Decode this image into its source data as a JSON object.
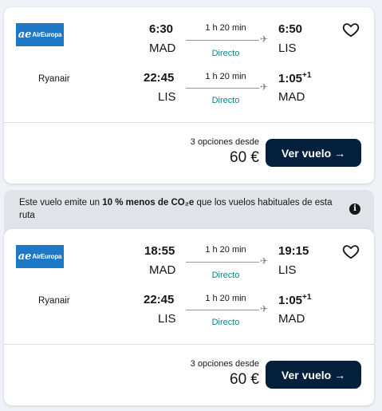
{
  "results": [
    {
      "airline_logo_text": "AirEuropa",
      "airline_logo_mark": "ae",
      "legs": [
        {
          "dep_time": "6:30",
          "dep_code": "MAD",
          "duration": "1 h 20 min",
          "stops": "Directo",
          "arr_time": "6:50",
          "arr_offset": "",
          "arr_code": "LIS"
        },
        {
          "airline": "Ryanair",
          "dep_time": "22:45",
          "dep_code": "LIS",
          "duration": "1 h 20 min",
          "stops": "Directo",
          "arr_time": "1:05",
          "arr_offset": "+1",
          "arr_code": "MAD"
        }
      ],
      "options_text": "3 opciones desde",
      "price": "60 €",
      "button_label": "Ver vuelo →"
    },
    {
      "airline_logo_text": "AirEuropa",
      "airline_logo_mark": "ae",
      "legs": [
        {
          "dep_time": "18:55",
          "dep_code": "MAD",
          "duration": "1 h 20 min",
          "stops": "Directo",
          "arr_time": "19:15",
          "arr_offset": "",
          "arr_code": "LIS"
        },
        {
          "airline": "Ryanair",
          "dep_time": "22:45",
          "dep_code": "LIS",
          "duration": "1 h 20 min",
          "stops": "Directo",
          "arr_time": "1:05",
          "arr_offset": "+1",
          "arr_code": "MAD"
        }
      ],
      "options_text": "3 opciones desde",
      "price": "60 €",
      "button_label": "Ver vuelo →"
    }
  ],
  "eco_banner": {
    "prefix": "Este vuelo emite un ",
    "highlight": "10 % menos de CO₂e",
    "suffix": " que los vuelos habituales de esta ruta"
  },
  "icons": {
    "plane": "plane-icon",
    "heart": "heart-icon",
    "info": "info-icon"
  },
  "colors": {
    "accent_dark": "#05203c",
    "direct_teal": "#0c838a",
    "aireuropa_blue": "#1d79c6"
  }
}
